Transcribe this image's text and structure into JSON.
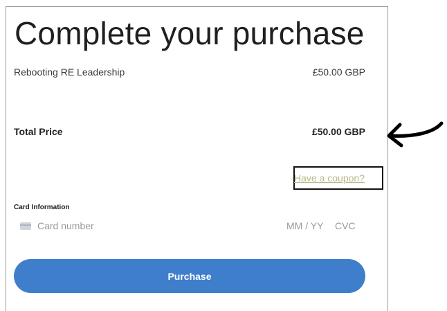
{
  "checkout": {
    "title": "Complete your purchase",
    "item_name": "Rebooting RE Leadership",
    "item_price": "£50.00 GBP",
    "total_label": "Total Price",
    "total_price": "£50.00 GBP",
    "coupon_link": "Have a coupon?"
  },
  "card": {
    "label": "Card Information",
    "number_placeholder": "Card number",
    "expiry_placeholder": "MM / YY",
    "cvc_placeholder": "CVC",
    "icon": "credit-card-icon"
  },
  "purchase_button": {
    "label": "Purchase",
    "color": "#3f7ecb"
  },
  "annotation": {
    "arrow_icon": "hand-drawn-arrow-icon",
    "highlight_color": "#111111"
  }
}
